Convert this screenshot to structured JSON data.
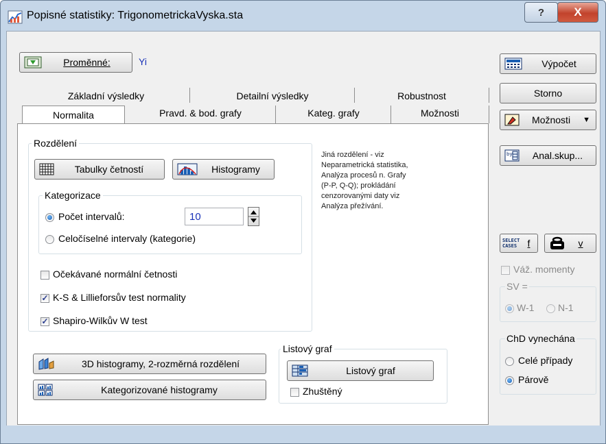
{
  "window": {
    "title": "Popisné statistiky: TrigonometrickaVyska.sta",
    "help_glyph": "?",
    "close_glyph": "X"
  },
  "variables": {
    "button_label": "Proměnné:",
    "selected": "Yi"
  },
  "tabs_back": [
    "Základní výsledky",
    "Detailní výsledky",
    "Robustnost"
  ],
  "tabs_front": [
    "Normalita",
    "Pravd. & bod. grafy",
    "Kateg. grafy",
    "Možnosti"
  ],
  "active_tab": "Normalita",
  "distribution": {
    "group_title": "Rozdělení",
    "freq_tables_label": "Tabulky četností",
    "histograms_label": "Histogramy",
    "categorization_title": "Kategorizace",
    "intervals_label": "Počet intervalů:",
    "intervals_value": "10",
    "integer_intervals_label": "Celočíselné intervaly (kategorie)",
    "intervals_mode": "count",
    "expected_normal_label": "Očekávané normální četnosti",
    "expected_normal_checked": false,
    "ks_label": "K-S & Lillieforsův test normality",
    "ks_checked": true,
    "shapiro_label": "Shapiro-Wilkův W test",
    "shapiro_checked": true
  },
  "info_text": [
    "Jiná rozdělení - viz",
    "Neparametrická statistika,",
    "Analýza procesů n. Grafy",
    "(P-P, Q-Q); prokládání",
    "cenzorovanými daty viz",
    "Analýza přežívání."
  ],
  "bottom": {
    "hist3d_label": "3D histogramy, 2-rozměrná rozdělení",
    "cat_hist_label": "Kategorizované histogramy",
    "stemleaf_group": "Listový graf",
    "stemleaf_button": "Listový graf",
    "compressed_label": "Zhuštěný",
    "compressed_checked": false
  },
  "right": {
    "compute_label": "Výpočet",
    "cancel_label": "Storno",
    "options_label": "Možnosti",
    "by_group_label": "Anal.skup...",
    "select_cases_icon": "SELECT CASES",
    "select_f": "f",
    "weight_v": "v",
    "weighted_moments_label": "Váž. momenty",
    "df_title": "SV =",
    "df_options": [
      "W-1",
      "N-1"
    ],
    "df_selected": "W-1",
    "md_title": "ChD vynechána",
    "md_options": [
      "Celé případy",
      "Párově"
    ],
    "md_selected": "Párově"
  }
}
